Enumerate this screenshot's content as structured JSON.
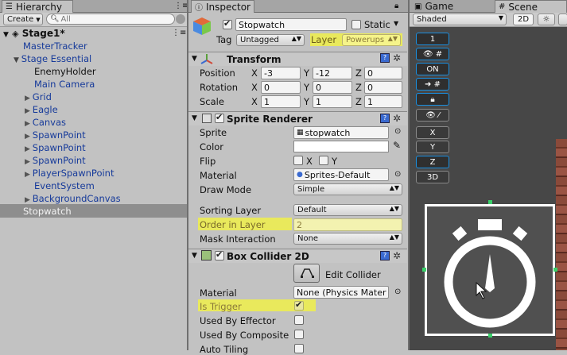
{
  "hierarchy": {
    "tab_label": "Hierarchy",
    "create_label": "Create",
    "search_placeholder": "All",
    "scene_name": "Stage1*",
    "items": [
      {
        "label": "MasterTracker"
      },
      {
        "label": "Stage Essential"
      },
      {
        "label": "EnemyHolder"
      },
      {
        "label": "Main Camera"
      },
      {
        "label": "Grid"
      },
      {
        "label": "Eagle"
      },
      {
        "label": "Canvas"
      },
      {
        "label": "SpawnPoint"
      },
      {
        "label": "SpawnPoint"
      },
      {
        "label": "SpawnPoint"
      },
      {
        "label": "PlayerSpawnPoint"
      },
      {
        "label": "EventSystem"
      },
      {
        "label": "BackgroundCanvas"
      },
      {
        "label": "Stopwatch"
      }
    ]
  },
  "inspector": {
    "tab_label": "Inspector",
    "object_name": "Stopwatch",
    "static_label": "Static",
    "tag_label": "Tag",
    "tag_value": "Untagged",
    "layer_label": "Layer",
    "layer_value": "Powerups",
    "transform": {
      "title": "Transform",
      "position_label": "Position",
      "rotation_label": "Rotation",
      "scale_label": "Scale",
      "x": "X",
      "y": "Y",
      "z": "Z",
      "position": [
        "-3",
        "-12",
        "0"
      ],
      "rotation": [
        "0",
        "0",
        "0"
      ],
      "scale": [
        "1",
        "1",
        "1"
      ]
    },
    "sprite_renderer": {
      "title": "Sprite Renderer",
      "sprite_label": "Sprite",
      "sprite_value": "stopwatch",
      "color_label": "Color",
      "flip_label": "Flip",
      "flip_x": "X",
      "flip_y": "Y",
      "material_label": "Material",
      "material_value": "Sprites-Default",
      "draw_mode_label": "Draw Mode",
      "draw_mode_value": "Simple",
      "sorting_layer_label": "Sorting Layer",
      "sorting_layer_value": "Default",
      "order_label": "Order in Layer",
      "order_value": "2",
      "mask_label": "Mask Interaction",
      "mask_value": "None"
    },
    "box_collider": {
      "title": "Box Collider 2D",
      "edit_collider_label": "Edit Collider",
      "material_label": "Material",
      "material_value": "None (Physics Mater",
      "is_trigger_label": "Is Trigger",
      "used_by_effector_label": "Used By Effector",
      "used_by_composite_label": "Used By Composite",
      "auto_tiling_label": "Auto Tiling"
    }
  },
  "game_tab": {
    "label": "Game"
  },
  "scene": {
    "tab_label": "Scene",
    "shading_value": "Shaded",
    "mode_2d_label": "2D",
    "tools": [
      "1",
      "ON",
      "X",
      "Y",
      "Z",
      "3D"
    ]
  }
}
